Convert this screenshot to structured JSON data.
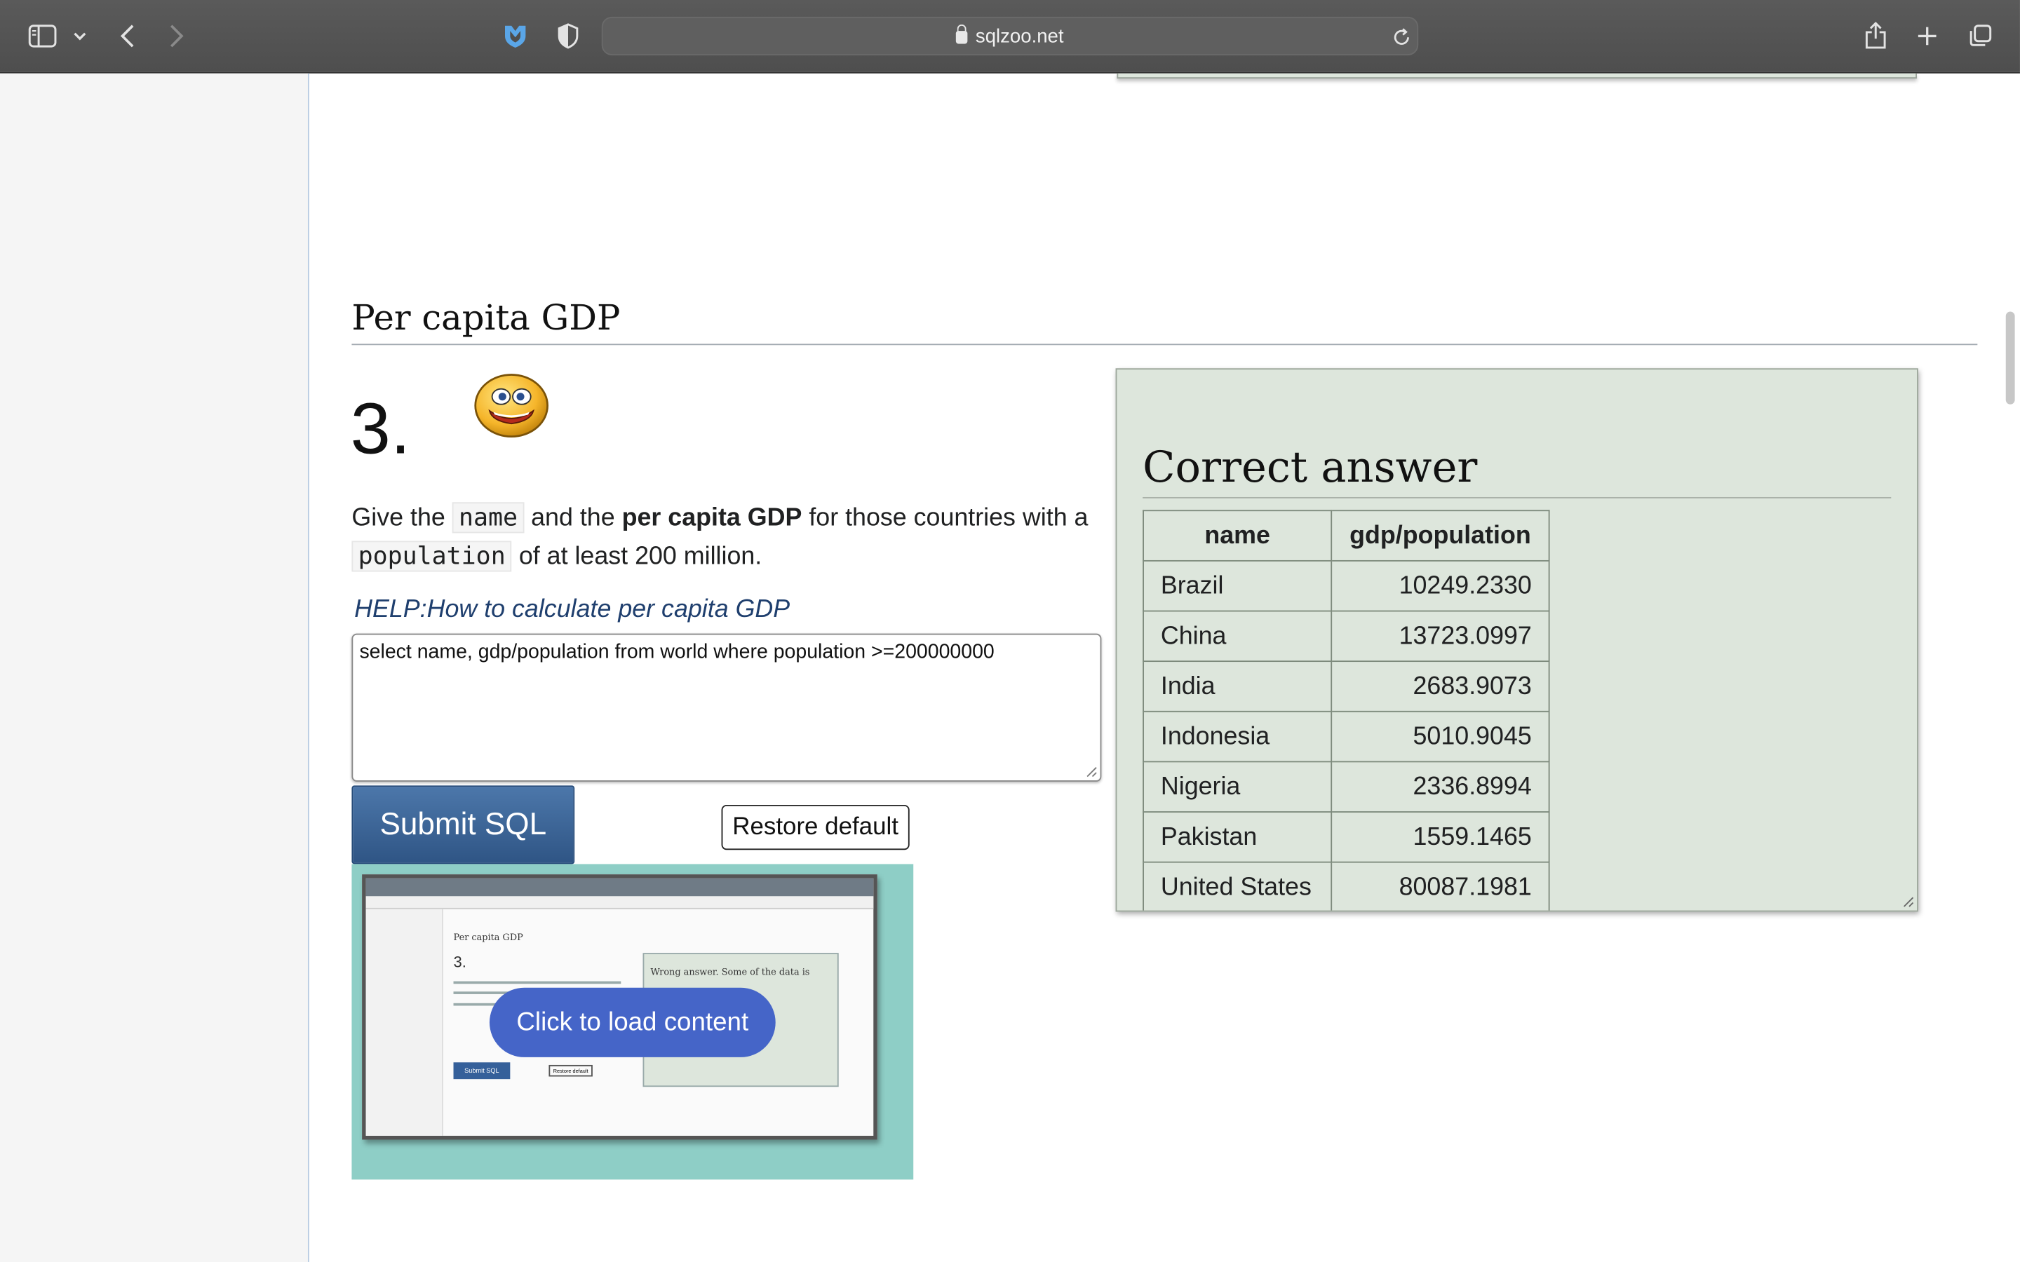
{
  "browser": {
    "url": "sqlzoo.net",
    "icons": [
      "sidebar-icon",
      "chevron-down-icon",
      "back-icon",
      "forward-icon",
      "extension-shield-icon",
      "privacy-shield-icon",
      "reload-icon",
      "share-icon",
      "new-tab-icon",
      "tabs-overview-icon"
    ]
  },
  "section": {
    "title": "Per capita GDP"
  },
  "question": {
    "number": "3.",
    "text_before_name": "Give the ",
    "code_name": "name",
    "text_and_the": " and the ",
    "bold_phrase": "per capita GDP",
    "text_for_those": " for those countries with a ",
    "code_population": "population",
    "text_after": " of at least 200 million.",
    "help_link": "HELP:How to calculate per capita GDP",
    "sql": "select name, gdp/population from world where population >=200000000",
    "submit_label": "Submit SQL",
    "restore_label": "Restore default",
    "load_content_label": "Click to load content",
    "thumbnail": {
      "title": "Per capita GDP",
      "number": "3.",
      "answer_text": "Wrong answer. Some of the data is",
      "submit_label": "Submit SQL",
      "restore_label": "Restore default"
    }
  },
  "answer": {
    "title": "Correct answer",
    "columns": [
      "name",
      "gdp/population"
    ],
    "rows": [
      [
        "Brazil",
        "10249.2330"
      ],
      [
        "China",
        "13723.0997"
      ],
      [
        "India",
        "2683.9073"
      ],
      [
        "Indonesia",
        "5010.9045"
      ],
      [
        "Nigeria",
        "2336.8994"
      ],
      [
        "Pakistan",
        "1559.1465"
      ],
      [
        "United States",
        "80087.1981"
      ]
    ]
  },
  "colors": {
    "toolbar": "#555555",
    "submit_button": "#3a6396",
    "answer_panel": "#dde6dc",
    "video_thumb_bg": "#8ecec6",
    "load_button": "#4565c8"
  }
}
